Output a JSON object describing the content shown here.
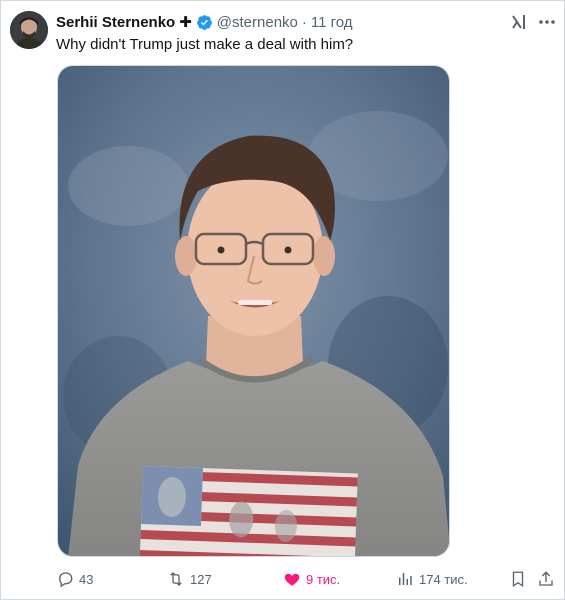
{
  "author": {
    "name": "Serhii Sternenko",
    "plus_badge": "✚",
    "handle": "@sternenko",
    "separator": "·",
    "time": "11 год"
  },
  "tweet": {
    "text": "Why didn't Trump just make a deal with him?"
  },
  "actions": {
    "replies": "43",
    "reposts": "127",
    "likes": "9 тис.",
    "views": "174 тис."
  },
  "colors": {
    "verified": "#1d9bf0",
    "like": "#f91880",
    "muted": "#536471"
  },
  "icons": [
    "verified-icon",
    "grok-icon",
    "more-icon",
    "reply-icon",
    "repost-icon",
    "like-icon",
    "views-icon",
    "bookmark-icon",
    "share-icon"
  ]
}
